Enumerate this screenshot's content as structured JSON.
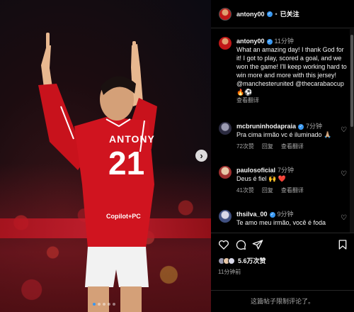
{
  "post": {
    "photo": {
      "jersey_name": "ANTONY",
      "jersey_number": "21",
      "sponsor": "Copilot+PC",
      "carousel_total": 5,
      "carousel_index": 1,
      "next_glyph": "›"
    },
    "header": {
      "username": "antony00",
      "separator": "•",
      "follow_label": "已关注"
    },
    "caption": {
      "username": "antony00",
      "time": "11分钟",
      "text": "What an amazing day! I thank God for it! I got to play, scored a goal, and we won the game! I'll keep working hard to win more and more with this jersey! @manchesterunited @thecarabaocup 🔥⚽",
      "translate": "查看翻译"
    },
    "comments": [
      {
        "username": "mcbruninhodapraia",
        "verified": true,
        "time": "7分钟",
        "text": "Pra cima irmão vc é iluminado 🙏🏼",
        "likes": "72次赞",
        "reply": "回复",
        "translate": "查看翻译"
      },
      {
        "username": "paulosoficial",
        "verified": false,
        "time": "7分钟",
        "text": "Deus é fiel 🙌 ❤️",
        "likes": "41次赞",
        "reply": "回复",
        "translate": "查看翻译"
      },
      {
        "username": "thsilva_00",
        "verified": true,
        "time": "9分钟",
        "text": "Te amo meu irmão, você é foda",
        "likes": "",
        "reply": "",
        "translate": ""
      }
    ],
    "actions": {
      "like_icon": "heart-icon",
      "comment_icon": "comment-icon",
      "share_icon": "share-icon",
      "save_icon": "bookmark-icon",
      "likes_label": "5.6万次赞",
      "posted_ago": "11分钟前",
      "comments_limited": "这篇帖子限制评论了。"
    },
    "colors": {
      "verified": "#3897f0",
      "jersey": "#d0141f",
      "background": "#000000"
    }
  }
}
